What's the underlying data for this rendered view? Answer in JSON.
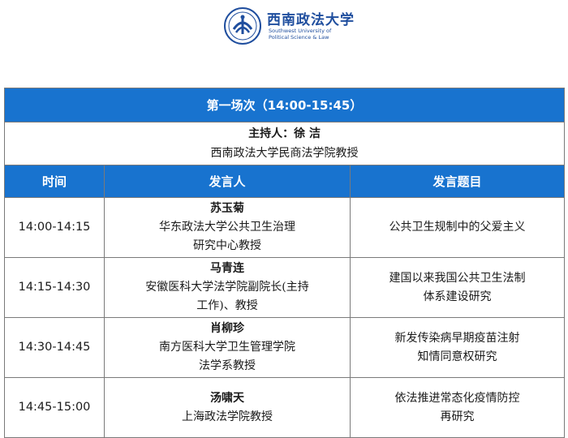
{
  "header": {
    "university_cn": "西南政法大学",
    "university_en_line1": "Southwest University of",
    "university_en_line2": "Political Science & Law",
    "brand_color": "#1f4e9e"
  },
  "session": {
    "title": "第一场次（14:00-15:45）",
    "host_label": "主持人：徐 洁",
    "host_title": "西南政法大学民商法学院教授"
  },
  "columns": {
    "time": "时间",
    "speaker": "发言人",
    "topic": "发言题目"
  },
  "talks": [
    {
      "time": "14:00-14:15",
      "name": "苏玉菊",
      "aff1": "华东政法大学公共卫生治理",
      "aff2": "研究中心教授",
      "topic1": "公共卫生规制中的父爱主义",
      "topic2": ""
    },
    {
      "time": "14:15-14:30",
      "name": "马青连",
      "aff1": "安徽医科大学法学院副院长(主持",
      "aff2": "工作)、教授",
      "topic1": "建国以来我国公共卫生法制",
      "topic2": "体系建设研究"
    },
    {
      "time": "14:30-14:45",
      "name": "肖柳珍",
      "aff1": "南方医科大学卫生管理学院",
      "aff2": "法学系教授",
      "topic1": "新发传染病早期疫苗注射",
      "topic2": "知情同意权研究"
    },
    {
      "time": "14:45-15:00",
      "name": "汤啸天",
      "aff1": "上海政法学院教授",
      "aff2": "",
      "topic1": "依法推进常态化疫情防控",
      "topic2": "再研究"
    }
  ],
  "colors": {
    "header_blue": "#1873cf",
    "border": "#7a7a7a"
  }
}
